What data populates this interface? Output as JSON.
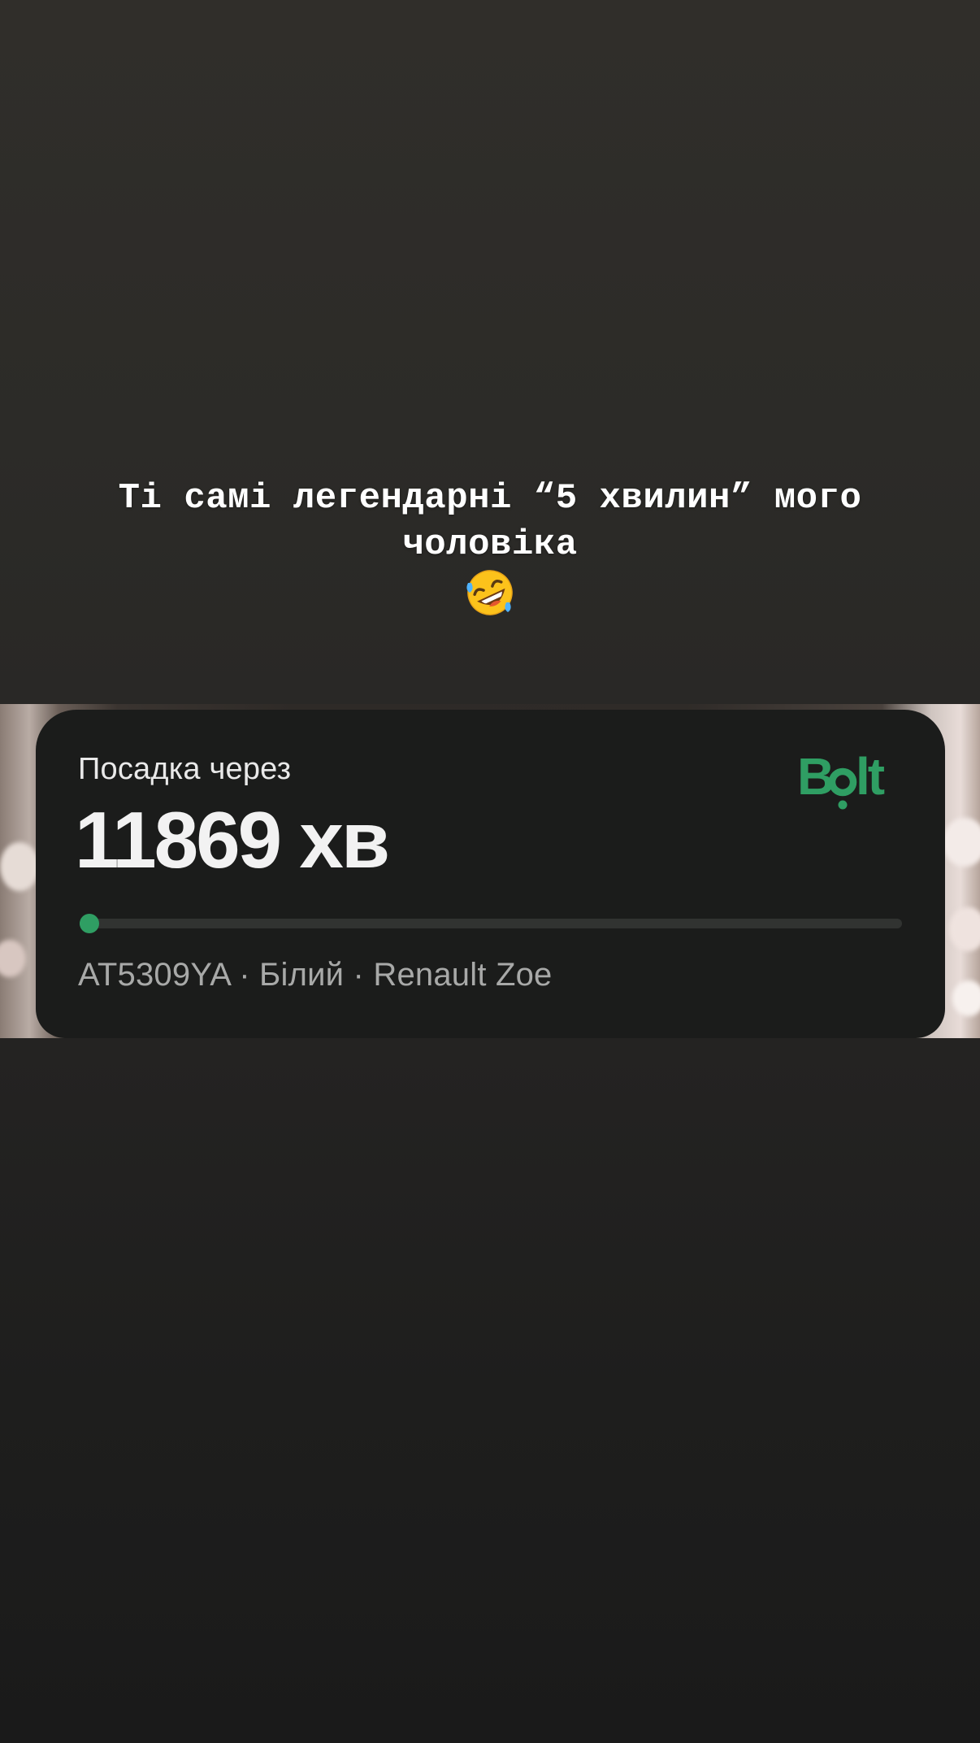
{
  "story": {
    "caption_line1": "Ті самі легендарні “5 хвилин” мого",
    "caption_line2": "чоловіка",
    "caption_emoji": "rolling-on-the-floor-laughing-emoji"
  },
  "bolt_card": {
    "subtitle": "Посадка через",
    "eta": "11869 хв",
    "brand": "Bolt",
    "brand_color": "#2f9e63",
    "progress_fraction": 0.01,
    "car_details": "AT5309YA · Білий · Renault Zoe"
  }
}
